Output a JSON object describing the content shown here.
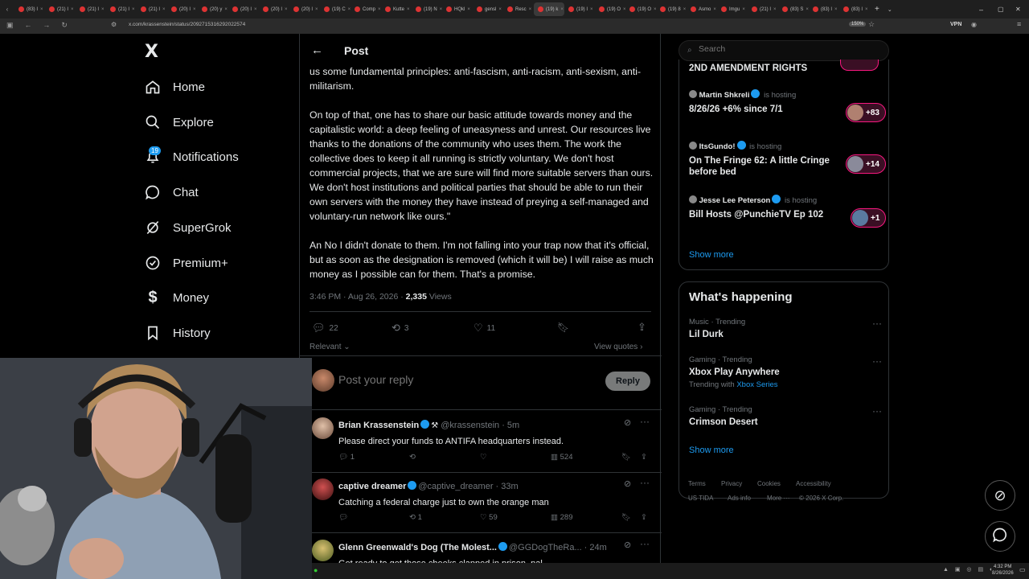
{
  "browser": {
    "tabs": [
      "(83) I",
      "(21) I",
      "(21) I",
      "(21) I",
      "(21) I",
      "(20) I",
      "(20) y",
      "(20) I",
      "(20) I",
      "(20) I",
      "(19) C",
      "Comp",
      "Kutte",
      "(19) N",
      "HQkl",
      "gensl",
      "Resc",
      "(19) k",
      "(19) I",
      "(19) O",
      "(19) O",
      "(19) 8",
      "Asmo",
      "Imgu",
      "(21) I",
      "(83) S",
      "(83) I",
      "(83) I"
    ],
    "url": "x.com/krassenstein/status/2092715316292022574",
    "zoom": "150%",
    "vpn_label": "VPN"
  },
  "sidebar": {
    "logo": "X",
    "items": [
      {
        "label": "Home",
        "icon": "home-icon"
      },
      {
        "label": "Explore",
        "icon": "search-icon"
      },
      {
        "label": "Notifications",
        "icon": "bell-icon",
        "badge": "19"
      },
      {
        "label": "Chat",
        "icon": "chat-icon"
      },
      {
        "label": "SuperGrok",
        "icon": "grok-icon"
      },
      {
        "label": "Premium+",
        "icon": "premium-icon"
      },
      {
        "label": "Money",
        "icon": "money-icon"
      },
      {
        "label": "History",
        "icon": "bookmark-icon"
      }
    ]
  },
  "post": {
    "header_title": "Post",
    "para1": "us some fundamental principles: anti-fascism, anti-racism, anti-sexism, anti-militarism.",
    "para2": "On top of that, one has to share our basic attitude towards money and the capitalistic world: a deep feeling of uneasyness and unrest.  Our resources live thanks to the donations of the community who uses them. The work the collective does to keep it all running is strictly voluntary. We don't host commercial projects, that we are sure will find more suitable servers than ours. We don't host institutions and political parties that should be able to run their own servers with the money they have instead of preying a self-managed and voluntary-run network like ours.\"",
    "para3": "An No I didn't donate to them.  I'm not falling into your trap now that it's official, but as soon as the designation is removed (which it will be) I will raise as much money as I possible can for them.  That's a promise.",
    "timestamp": "3:46 PM · Aug 26, 2026 ·",
    "views_count": "2,335",
    "views_label": "Views",
    "replies": "22",
    "reposts": "3",
    "likes": "11",
    "relevant_label": "Relevant",
    "view_quotes": "View quotes",
    "reply_placeholder": "Post your reply",
    "reply_button": "Reply"
  },
  "replies": [
    {
      "name": "Brian Krassenstein",
      "handle": "@krassenstein · 5m",
      "text": "Please direct your funds to ANTIFA headquarters instead.",
      "comments": "1",
      "reposts": "",
      "likes": "",
      "views": "524"
    },
    {
      "name": "captive dreamer",
      "handle": "@captive_dreamer · 33m",
      "text": "Catching a federal charge just to own the orange man",
      "comments": "",
      "reposts": "1",
      "likes": "59",
      "views": "289"
    },
    {
      "name": "Glenn Greenwald's Dog (The Molest...",
      "handle": "@GGDogTheRa... · 24m",
      "text": "Get ready to get those cheeks clapped in prison, pal"
    }
  ],
  "right_sidebar": {
    "search_placeholder": "Search",
    "spaces_top_title": "2ND AMENDMENT RIGHTS",
    "spaces": [
      {
        "host": "Martin Shkreli",
        "status": "is hosting",
        "title": "8/26/26 +6% since 7/1",
        "count": "+83"
      },
      {
        "host": "ItsGundo!",
        "status": "is hosting",
        "title": "On The Fringe 62: A little Cringe before bed",
        "count": "+14"
      },
      {
        "host": "Jesse Lee Peterson",
        "status": "is hosting",
        "title": "Bill Hosts @PunchieTV Ep 102",
        "count": "+1"
      }
    ],
    "show_more_1": "Show more",
    "happening_title": "What's happening",
    "trends": [
      {
        "meta": "Music · Trending",
        "title": "Lil Durk",
        "extra": ""
      },
      {
        "meta": "Gaming · Trending",
        "title": "Xbox Play Anywhere",
        "extra_prefix": "Trending with",
        "extra": "Xbox Series"
      },
      {
        "meta": "Gaming · Trending",
        "title": "Crimson Desert",
        "extra": ""
      }
    ],
    "show_more_2": "Show more",
    "footer": [
      "Terms",
      "Privacy",
      "Cookies",
      "Accessibility",
      "US TIDA",
      "Ads info",
      "More ···",
      "© 2026 X Corp."
    ]
  },
  "system": {
    "time": "4:32 PM",
    "date": "8/26/2026"
  },
  "colors": {
    "accent": "#1d9bf0",
    "spaces_pink": "#f91880",
    "bg": "#000000",
    "muted": "#71767b"
  }
}
